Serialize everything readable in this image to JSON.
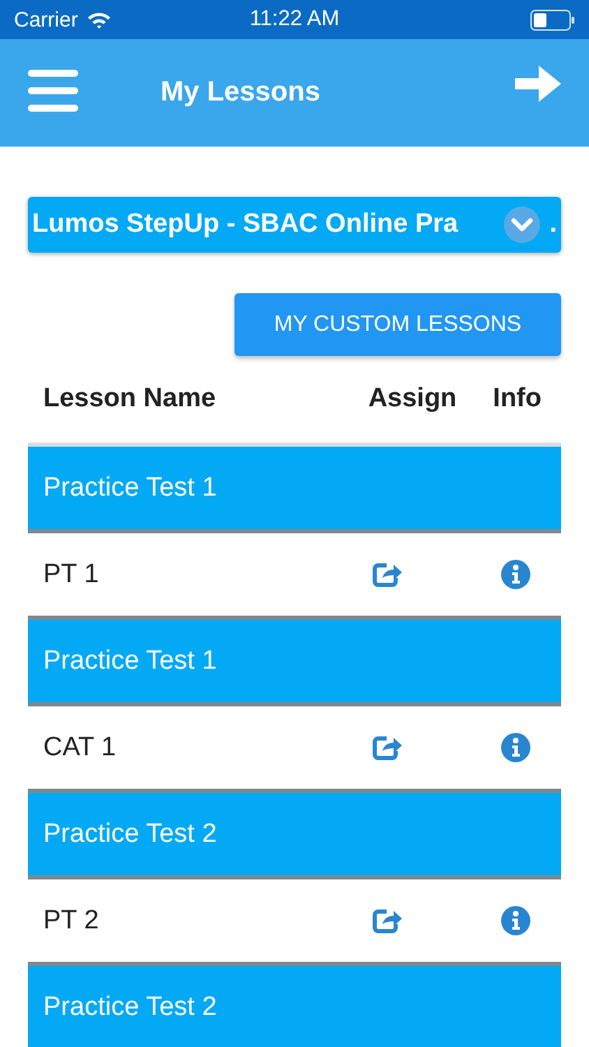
{
  "status_bar": {
    "carrier": "Carrier",
    "time": "11:22 AM"
  },
  "header": {
    "title": "My Lessons"
  },
  "picker": {
    "value": "Lumos StepUp - SBAC Online Pra",
    "trailing": "."
  },
  "custom_button": {
    "label": "MY CUSTOM LESSONS"
  },
  "table": {
    "columns": [
      "Lesson Name",
      "Assign",
      "Info"
    ],
    "rows": [
      {
        "kind": "group",
        "name": "Practice Test 1"
      },
      {
        "kind": "lesson",
        "name": "PT 1"
      },
      {
        "kind": "group",
        "name": "Practice Test 1"
      },
      {
        "kind": "lesson",
        "name": "CAT 1"
      },
      {
        "kind": "group",
        "name": "Practice Test 2"
      },
      {
        "kind": "lesson",
        "name": "PT 2"
      },
      {
        "kind": "group",
        "name": "Practice Test 2"
      }
    ]
  }
}
